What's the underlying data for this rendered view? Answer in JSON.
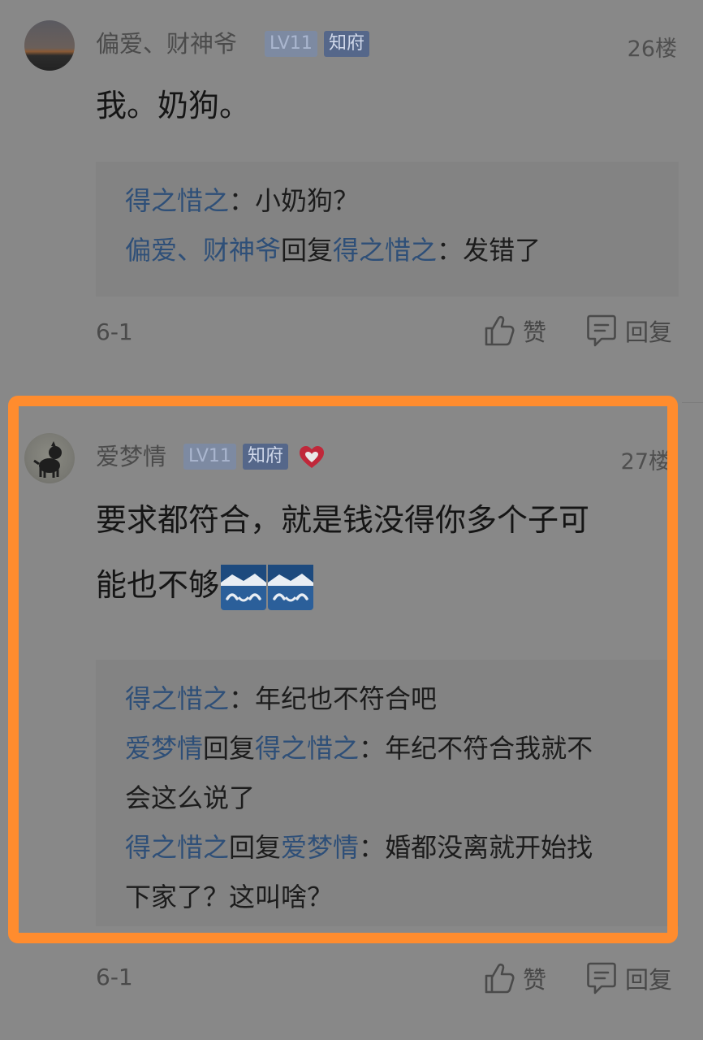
{
  "posts": [
    {
      "username": "偏爱、财神爷",
      "level": "LV11",
      "title_badge": "知府",
      "floor": "26楼",
      "content": "我。奶狗。",
      "replies": [
        {
          "from": "得之惜之",
          "to": "",
          "sep": "：",
          "text": "小奶狗？"
        },
        {
          "from": "偏爱、财神爷",
          "reply_word": "回复",
          "to": "得之惜之",
          "sep": "：",
          "text": "发错了"
        }
      ],
      "time": "6-1",
      "like_label": "赞",
      "reply_label": "回复"
    },
    {
      "username": "爱梦情",
      "level": "LV11",
      "title_badge": "知府",
      "floor": "27楼",
      "content_line1": "要求都符合，就是钱没得你多个子可",
      "content_line2": "能也不够",
      "emoji": "blue-smile-emoji",
      "replies": [
        {
          "from": "得之惜之",
          "sep": "：",
          "text": "年纪也不符合吧"
        },
        {
          "from": "爱梦情",
          "reply_word": "回复",
          "to": "得之惜之",
          "sep": "：",
          "text_line1": "年纪不符合我就不",
          "text_line2": "会这么说了"
        },
        {
          "from": "得之惜之",
          "reply_word": "回复",
          "to": "爱梦情",
          "sep": "：",
          "text_line1": "婚都没离就开始找",
          "text_line2": "下家了？这叫啥？"
        }
      ],
      "time": "6-1",
      "like_label": "赞",
      "reply_label": "回复"
    }
  ],
  "colors": {
    "background": "#888888",
    "username_link": "#2e4f78",
    "highlight_border": "#ff8c2e",
    "badge_level": "#7d8aa2",
    "badge_title": "#55678a",
    "heart": "#c0283a"
  },
  "icons": [
    "thumbs-up-icon",
    "comment-icon",
    "heart-badge-icon"
  ]
}
